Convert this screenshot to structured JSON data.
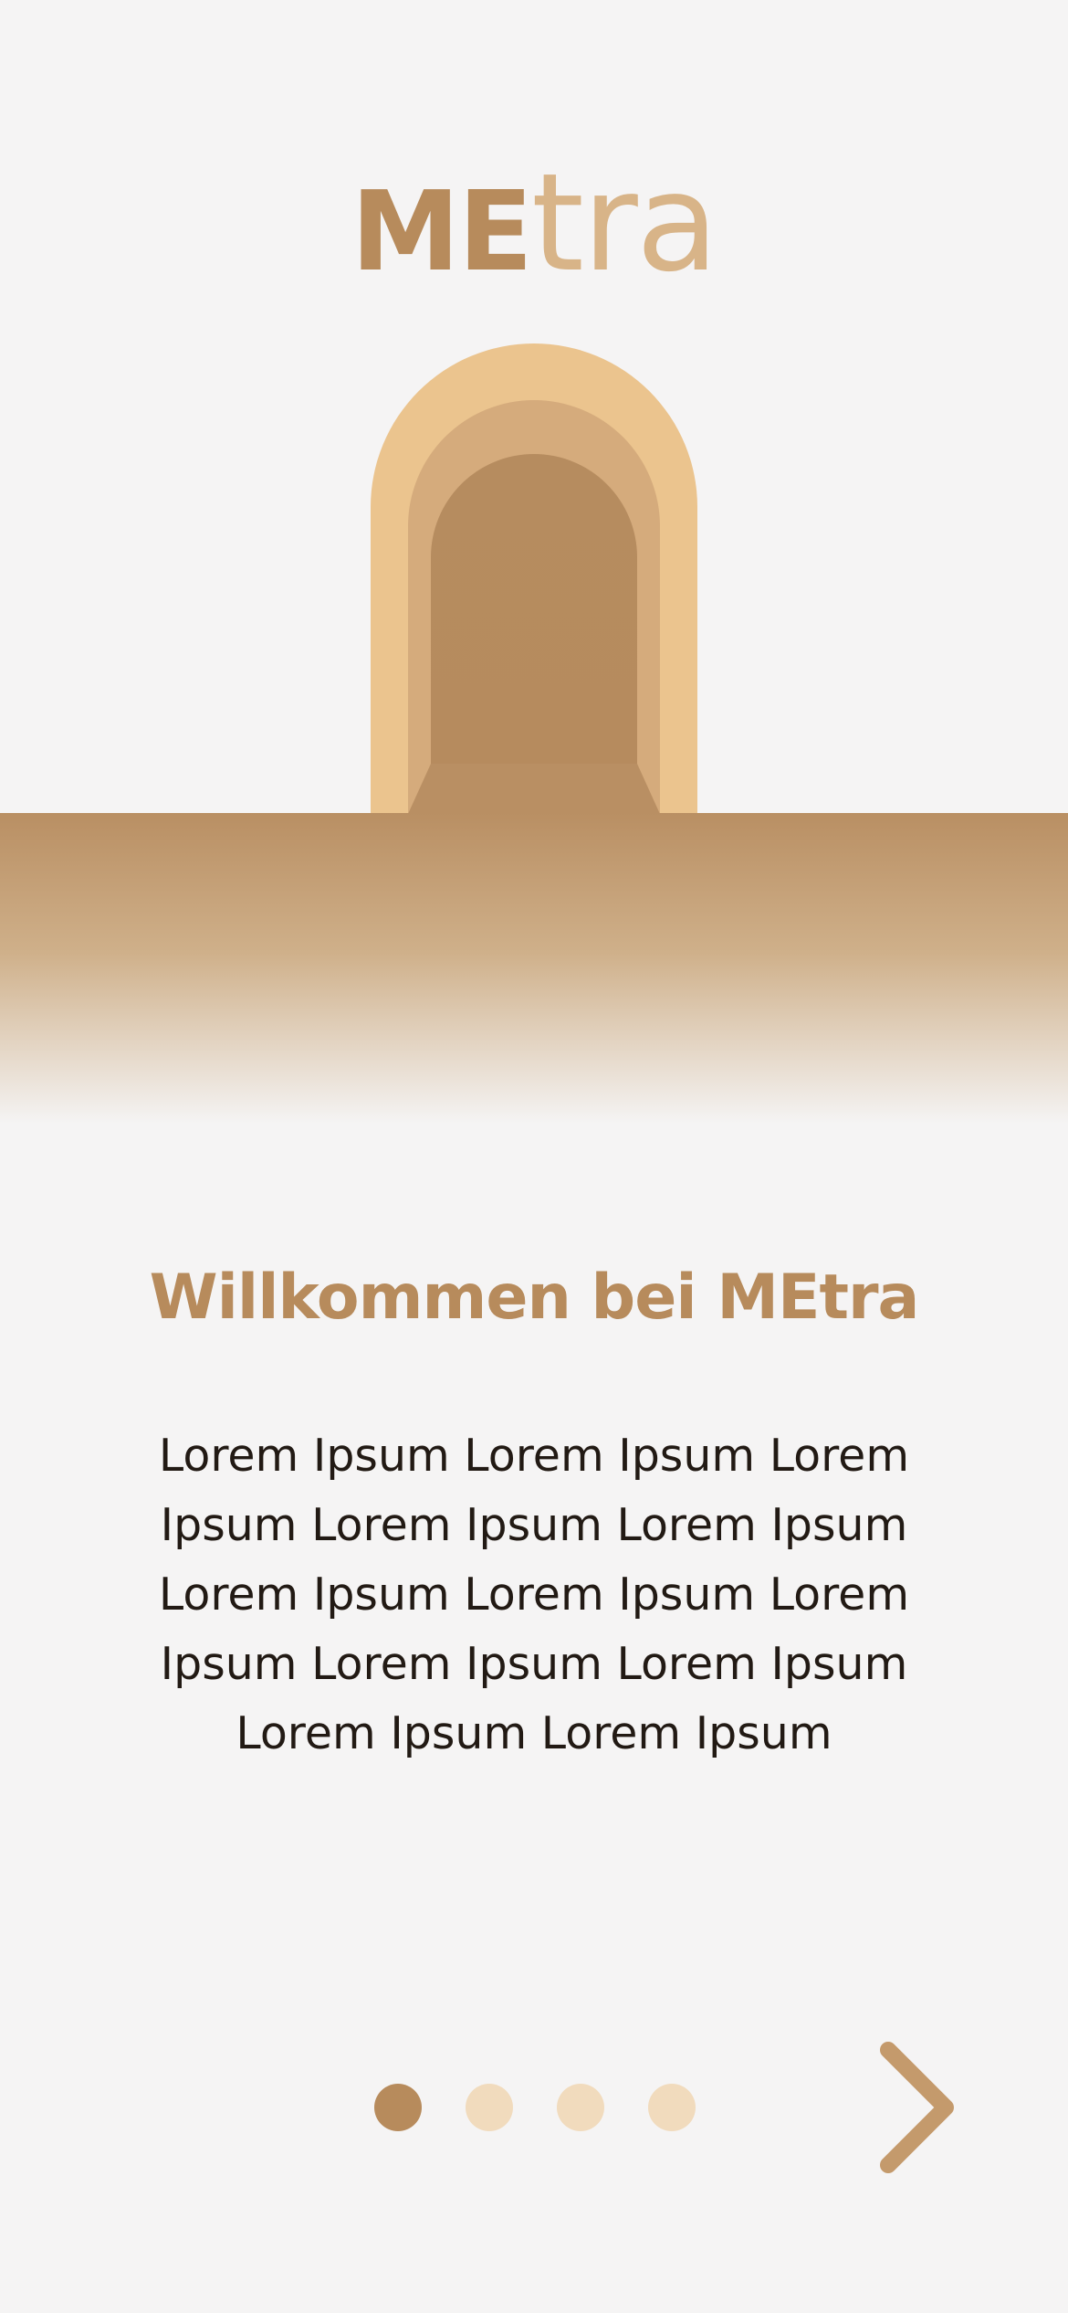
{
  "logo": {
    "strong": "ME",
    "light": "tra"
  },
  "welcome": {
    "title": "Willkommen bei MEtra",
    "body": "Lorem Ipsum Lorem Ipsum Lorem Ipsum Lorem Ipsum Lorem Ipsum Lorem Ipsum Lorem Ipsum Lorem Ipsum Lorem Ipsum Lorem Ipsum Lorem Ipsum Lorem Ipsum"
  },
  "pagination": {
    "total_pages": 4,
    "current_page": 1
  },
  "icons": {
    "next": "chevron-right-icon",
    "illustration": "archway-illustration"
  },
  "colors": {
    "background": "#f5f4f4",
    "brand": "#b78b5c",
    "brand_light": "#d8b488",
    "arch_outer": "#ebc48e",
    "arch_middle": "#d5ab7c",
    "arch_inner": "#b78b5c",
    "dot_inactive": "#f1dbbd",
    "text": "#221a14"
  }
}
